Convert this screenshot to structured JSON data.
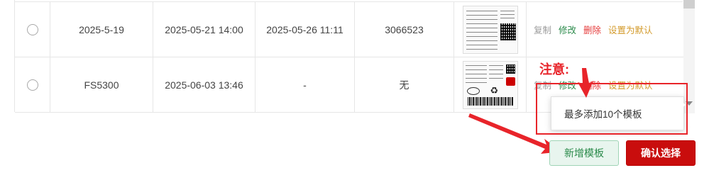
{
  "table": {
    "rows": [
      {
        "name": "2025-5-19",
        "created": "2025-05-21 14:00",
        "updated": "2025-05-26 11:11",
        "code": "3066523",
        "actions": {
          "copy": "复制",
          "edit": "修改",
          "delete": "删除",
          "set_default": "设置为默认"
        }
      },
      {
        "name": "FS5300",
        "created": "2025-06-03 13:46",
        "updated": "-",
        "code": "无",
        "actions": {
          "copy": "复制",
          "edit": "修改",
          "delete": "删除",
          "set_default": "设置为默认"
        }
      }
    ]
  },
  "annotation": {
    "note": "注意:",
    "tooltip": "最多添加10个模板",
    "color": "#e8242a"
  },
  "buttons": {
    "add_template": "新增模板",
    "confirm": "确认选择"
  },
  "icons": {
    "radio": "radio-circle",
    "qr": "qr-code",
    "barcode": "barcode",
    "recycle": "recycle-icon"
  }
}
